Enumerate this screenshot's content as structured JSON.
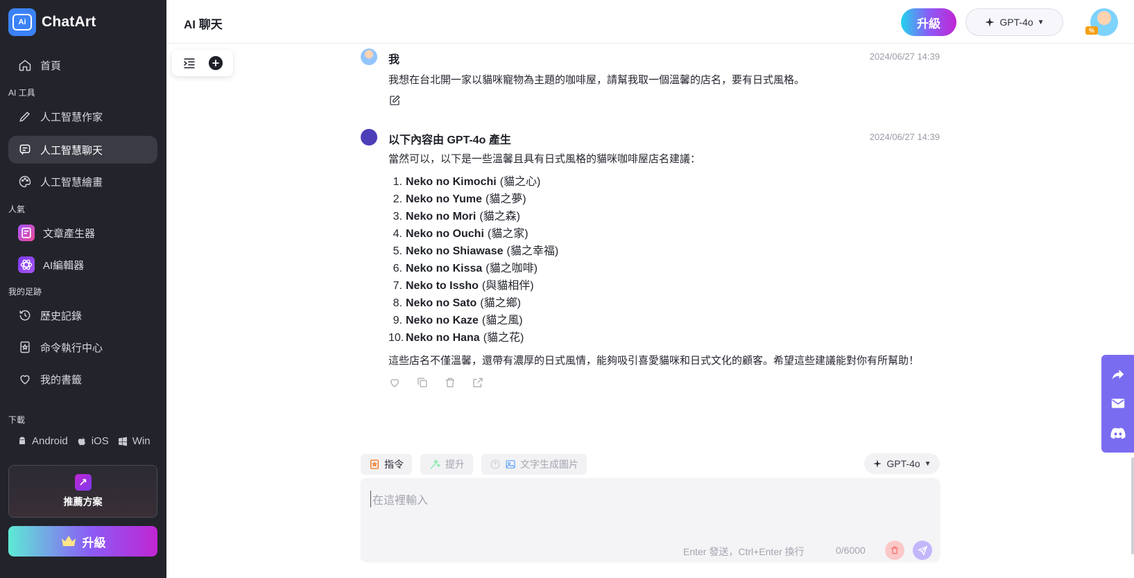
{
  "app": {
    "name": "ChatArt",
    "logo_mark": "Ai"
  },
  "header": {
    "title": "AI 聊天",
    "upgrade_label": "升級",
    "model": "GPT-4o",
    "avatar_badge": "%"
  },
  "sidebar": {
    "items": [
      {
        "label": "首頁",
        "icon": "home-icon"
      },
      {
        "label": "人工智慧作家",
        "icon": "pen-icon"
      },
      {
        "label": "人工智慧聊天",
        "icon": "chat-icon",
        "active": true
      },
      {
        "label": "人工智慧繪畫",
        "icon": "palette-icon"
      },
      {
        "label": "文章產生器",
        "icon": "article-icon"
      },
      {
        "label": "AI編輯器",
        "icon": "atom-icon"
      },
      {
        "label": "歷史記錄",
        "icon": "history-icon"
      },
      {
        "label": "命令執行中心",
        "icon": "command-icon"
      },
      {
        "label": "我的書籤",
        "icon": "heart-icon"
      }
    ],
    "sections": {
      "ai_tools": "AI 工具",
      "popular": "人氣",
      "footprint": "我的足跡",
      "download": "下載"
    },
    "downloads": {
      "android": "Android",
      "ios": "iOS",
      "win": "Win"
    },
    "promo_label": "推薦方案",
    "upgrade_label": "升級"
  },
  "messages": [
    {
      "author": "我",
      "time": "2024/06/27 14:39",
      "text": "我想在台北開一家以貓咪寵物為主題的咖啡屋，請幫我取一個溫馨的店名，要有日式風格。"
    },
    {
      "author": "以下內容由 GPT-4o 產生",
      "time": "2024/06/27 14:39",
      "intro": "當然可以，以下是一些溫馨且具有日式風格的貓咪咖啡屋店名建議：",
      "names": [
        {
          "num": "1.",
          "name": "Neko no Kimochi",
          "meaning": "(貓之心)"
        },
        {
          "num": "2.",
          "name": "Neko no Yume",
          "meaning": "(貓之夢)"
        },
        {
          "num": "3.",
          "name": "Neko no Mori",
          "meaning": "(貓之森)"
        },
        {
          "num": "4.",
          "name": "Neko no Ouchi",
          "meaning": "(貓之家)"
        },
        {
          "num": "5.",
          "name": "Neko no Shiawase",
          "meaning": "(貓之幸福)"
        },
        {
          "num": "6.",
          "name": "Neko no Kissa",
          "meaning": "(貓之咖啡)"
        },
        {
          "num": "7.",
          "name": "Neko to Issho",
          "meaning": "(與貓相伴)"
        },
        {
          "num": "8.",
          "name": "Neko no Sato",
          "meaning": "(貓之鄉)"
        },
        {
          "num": "9.",
          "name": "Neko no Kaze",
          "meaning": "(貓之風)"
        },
        {
          "num": "10.",
          "name": "Neko no Hana",
          "meaning": "(貓之花)"
        }
      ],
      "outro": "這些店名不僅溫馨，還帶有濃厚的日式風情，能夠吸引喜愛貓咪和日式文化的顧客。希望這些建議能對你有所幫助！"
    }
  ],
  "composer": {
    "chips": {
      "prompt": "指令",
      "enhance": "提升",
      "text_to_image": "文字生成圖片"
    },
    "model": "GPT-4o",
    "placeholder": "在這裡輸入",
    "hint": "Enter 發送，Ctrl+Enter 換行",
    "count": "0/6000"
  },
  "colors": {
    "sidebar_bg": "#23242b",
    "accent": "#8b5cf6",
    "float_panel": "#7a6cf0"
  }
}
